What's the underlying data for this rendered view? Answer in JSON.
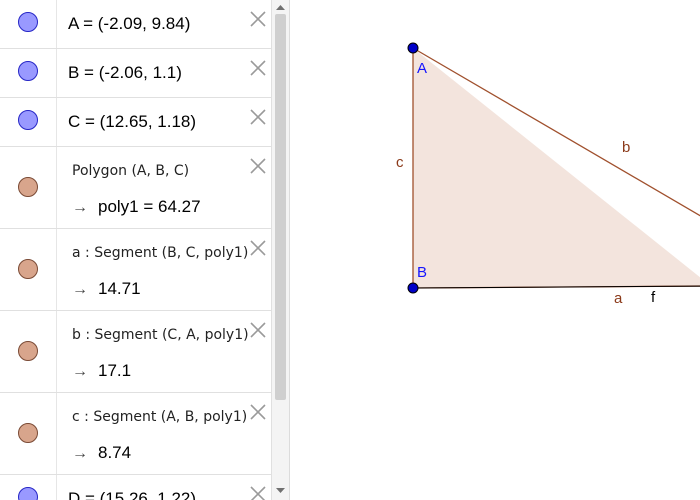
{
  "algebra": {
    "points": [
      {
        "id": "point-A",
        "text": "A = (-2.09, 9.84)"
      },
      {
        "id": "point-B",
        "text": "B = (-2.06, 1.1)"
      },
      {
        "id": "point-C",
        "text": "C = (12.65, 1.18)"
      }
    ],
    "dependents": [
      {
        "id": "polygon-poly1",
        "definition": "Polygon (A, B, C)",
        "value": "poly1 = 64.27"
      },
      {
        "id": "segment-a",
        "definition": "a : Segment (B, C, poly1)",
        "value": "14.71"
      },
      {
        "id": "segment-b",
        "definition": "b : Segment (C, A, poly1)",
        "value": "17.1"
      },
      {
        "id": "segment-c",
        "definition": "c : Segment (A, B, poly1)",
        "value": "8.74"
      }
    ],
    "partial_point": {
      "id": "point-D",
      "text": "D = (15.26, 1.22)"
    },
    "arrow_glyph": "→"
  },
  "graphics": {
    "labels": {
      "A": "A",
      "B": "B",
      "b": "b",
      "c": "c",
      "a": "a",
      "f": "f"
    },
    "colors": {
      "fill": "#f3e4dd",
      "edge": "#a0502d",
      "point": "#0000c8",
      "point_label": "#1414ff",
      "segment_label": "#8b3a1a",
      "line_f": "#000000"
    }
  },
  "colors": {
    "free_marble": "#9999ff",
    "dependent_marble": "#d8a58c",
    "close": "#9a9a9a"
  }
}
